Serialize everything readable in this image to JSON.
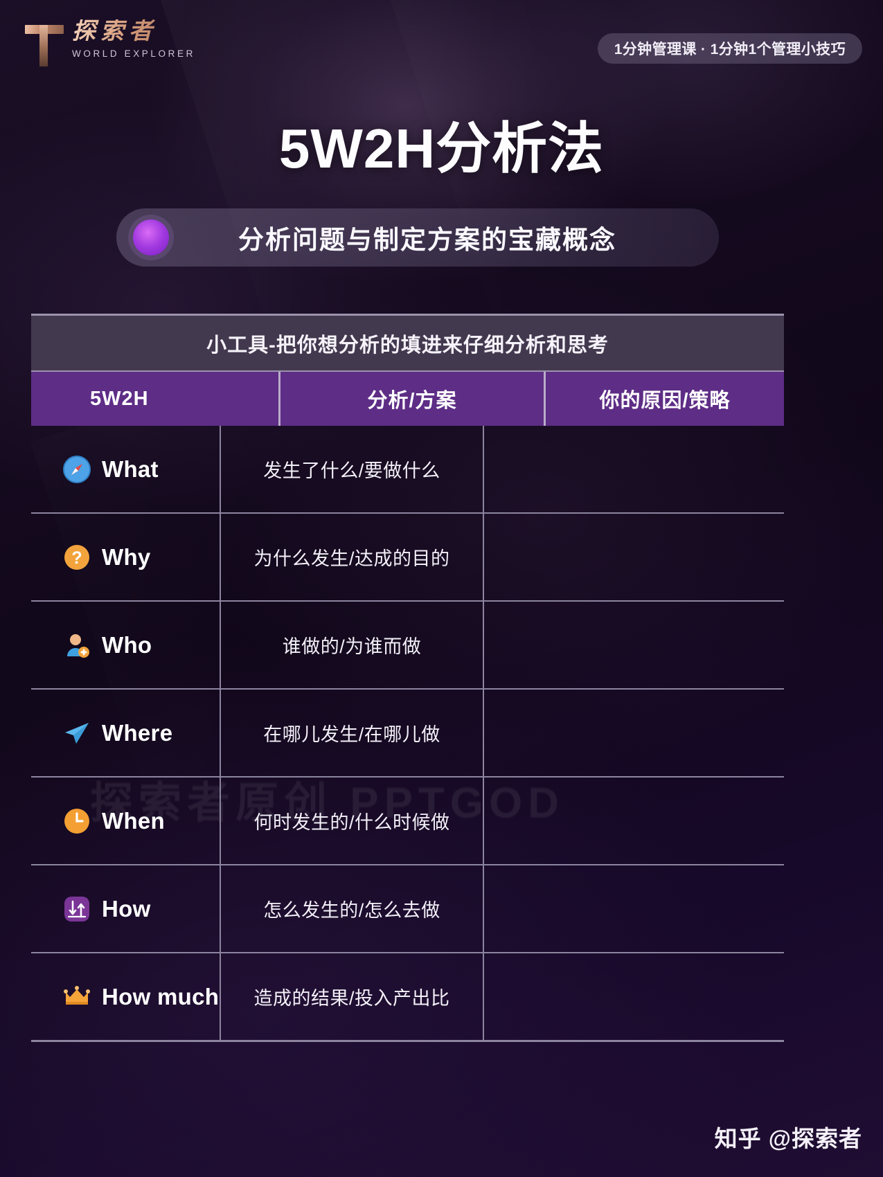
{
  "brand": {
    "logo_mark": "T",
    "name_cn": "探索者",
    "name_en": "WORLD EXPLORER"
  },
  "header": {
    "badge": "1分钟管理课 · 1分钟1个管理小技巧"
  },
  "title": "5W2H分析法",
  "subtitle": "分析问题与制定方案的宝藏概念",
  "watermark": "探索者原创  PPTGOD",
  "footer": "知乎 @探索者",
  "colors": {
    "accent_purple": "#5e2d86",
    "caption_gray": "#43394f",
    "grid_line": "#8d85a0",
    "background": "#14081d",
    "text_white": "#ffffff"
  },
  "table": {
    "caption": "小工具-把你想分析的填进来仔细分析和思考",
    "columns": [
      "5W2H",
      "分析/方案",
      "你的原因/策略"
    ],
    "rows": [
      {
        "icon": "compass-icon",
        "label": "What",
        "analysis": "发生了什么/要做什么",
        "answer": ""
      },
      {
        "icon": "question-icon",
        "label": "Why",
        "analysis": "为什么发生/达成的目的",
        "answer": ""
      },
      {
        "icon": "person-add-icon",
        "label": "Who",
        "analysis": "谁做的/为谁而做",
        "answer": ""
      },
      {
        "icon": "paper-plane-icon",
        "label": "Where",
        "analysis": "在哪儿发生/在哪儿做",
        "answer": ""
      },
      {
        "icon": "clock-icon",
        "label": "When",
        "analysis": "何时发生的/什么时候做",
        "answer": ""
      },
      {
        "icon": "sliders-icon",
        "label": "How",
        "analysis": "怎么发生的/怎么去做",
        "answer": ""
      },
      {
        "icon": "crown-icon",
        "label": "How much",
        "analysis": "造成的结果/投入产出比",
        "answer": ""
      }
    ]
  }
}
